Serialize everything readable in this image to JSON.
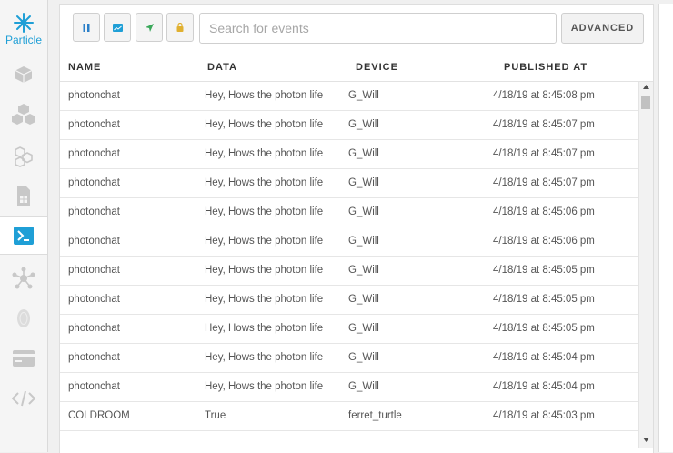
{
  "logo": {
    "text": "Particle"
  },
  "sidebar": {
    "items": [
      {
        "name": "devices"
      },
      {
        "name": "products"
      },
      {
        "name": "networks"
      },
      {
        "name": "sim-cards"
      },
      {
        "name": "console",
        "active": true
      },
      {
        "name": "integrations"
      },
      {
        "name": "authentication"
      },
      {
        "name": "billing"
      },
      {
        "name": "code"
      }
    ]
  },
  "toolbar": {
    "search_placeholder": "Search for events",
    "advanced_label": "ADVANCED",
    "buttons": [
      "pause",
      "image",
      "send",
      "lock"
    ]
  },
  "table": {
    "headers": {
      "name": "NAME",
      "data": "DATA",
      "device": "DEVICE",
      "published": "PUBLISHED AT"
    },
    "rows": [
      {
        "name": "photonchat",
        "data": "Hey, Hows the photon life",
        "device": "G_Will",
        "published": "4/18/19 at 8:45:08 pm"
      },
      {
        "name": "photonchat",
        "data": "Hey, Hows the photon life",
        "device": "G_Will",
        "published": "4/18/19 at 8:45:07 pm"
      },
      {
        "name": "photonchat",
        "data": "Hey, Hows the photon life",
        "device": "G_Will",
        "published": "4/18/19 at 8:45:07 pm"
      },
      {
        "name": "photonchat",
        "data": "Hey, Hows the photon life",
        "device": "G_Will",
        "published": "4/18/19 at 8:45:07 pm"
      },
      {
        "name": "photonchat",
        "data": "Hey, Hows the photon life",
        "device": "G_Will",
        "published": "4/18/19 at 8:45:06 pm"
      },
      {
        "name": "photonchat",
        "data": "Hey, Hows the photon life",
        "device": "G_Will",
        "published": "4/18/19 at 8:45:06 pm"
      },
      {
        "name": "photonchat",
        "data": "Hey, Hows the photon life",
        "device": "G_Will",
        "published": "4/18/19 at 8:45:05 pm"
      },
      {
        "name": "photonchat",
        "data": "Hey, Hows the photon life",
        "device": "G_Will",
        "published": "4/18/19 at 8:45:05 pm"
      },
      {
        "name": "photonchat",
        "data": "Hey, Hows the photon life",
        "device": "G_Will",
        "published": "4/18/19 at 8:45:05 pm"
      },
      {
        "name": "photonchat",
        "data": "Hey, Hows the photon life",
        "device": "G_Will",
        "published": "4/18/19 at 8:45:04 pm"
      },
      {
        "name": "photonchat",
        "data": "Hey, Hows the photon life",
        "device": "G_Will",
        "published": "4/18/19 at 8:45:04 pm"
      },
      {
        "name": "COLDROOM",
        "data": "True",
        "device": "ferret_turtle",
        "published": "4/18/19 at 8:45:03 pm"
      }
    ]
  },
  "colors": {
    "brand": "#1f9fd6",
    "pause": "#2a7fc8",
    "image": "#1f9fd6",
    "send": "#3aa85a",
    "lock": "#e0b030"
  }
}
